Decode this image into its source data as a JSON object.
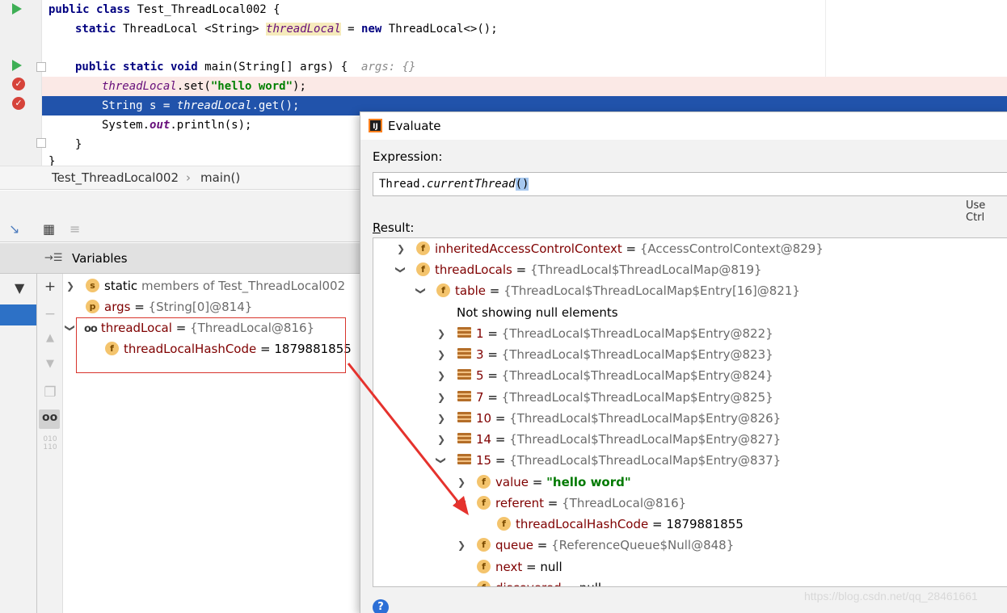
{
  "editor": {
    "class_decl": "public class Test_ThreadLocal002 {",
    "kw_public_class": "public class",
    "class_name": "Test_ThreadLocal002 {",
    "field_kw": "static",
    "field_type": "ThreadLocal <String>",
    "field_name": "threadLocal",
    "field_rest": "= new ThreadLocal<>();",
    "kw_new": "new",
    "field_ctor": "ThreadLocal<>();",
    "main_kw": "public static void",
    "main_sig": "main(String[] args) {",
    "main_hint": "args: {}",
    "line_set_var": "threadLocal",
    "line_set_call": ".set(",
    "line_set_str": "\"hello word\"",
    "line_set_end": ");",
    "line_get_pre": "String s = ",
    "line_get_var": "threadLocal",
    "line_get_end": ".get();",
    "line_print_pre": "System.",
    "line_print_out": "out",
    "line_print_end": ".println(s);",
    "close_brace": "}",
    "close_brace2": "}"
  },
  "breadcrumb": {
    "file": "Test_ThreadLocal002",
    "sep": "›",
    "method": "main()"
  },
  "variables": {
    "header": "Variables",
    "rows": [
      {
        "badge": "s",
        "name": "static",
        "rest": "members of Test_ThreadLocal002"
      },
      {
        "badge": "p",
        "name": "args",
        "eq": " = ",
        "value": "{String[0]@814}"
      },
      {
        "name": "threadLocal",
        "eq": " = ",
        "value": "{ThreadLocal@816}"
      },
      {
        "badge": "f",
        "name": "threadLocalHashCode",
        "eq": " = ",
        "value": "1879881855"
      }
    ]
  },
  "evaluate": {
    "title": "Evaluate",
    "expression_label": "Expression:",
    "expression_main": "Thread.",
    "expression_method": "currentThread",
    "expression_paren": "()",
    "use_ctrl": "Use Ctrl",
    "result_label_u": "R",
    "result_label_rest": "esult:",
    "tree": [
      {
        "name": "inheritedAccessControlContext",
        "eq": " = ",
        "value": "{AccessControlContext@829}"
      },
      {
        "name": "threadLocals",
        "eq": " = ",
        "value": "{ThreadLocal$ThreadLocalMap@819}"
      },
      {
        "name": "table",
        "eq": " = ",
        "value": "{ThreadLocal$ThreadLocalMap$Entry[16]@821}"
      },
      {
        "text": "Not showing null elements"
      },
      {
        "name": "1",
        "eq": " = ",
        "value": "{ThreadLocal$ThreadLocalMap$Entry@822}"
      },
      {
        "name": "3",
        "eq": " = ",
        "value": "{ThreadLocal$ThreadLocalMap$Entry@823}"
      },
      {
        "name": "5",
        "eq": " = ",
        "value": "{ThreadLocal$ThreadLocalMap$Entry@824}"
      },
      {
        "name": "7",
        "eq": " = ",
        "value": "{ThreadLocal$ThreadLocalMap$Entry@825}"
      },
      {
        "name": "10",
        "eq": " = ",
        "value": "{ThreadLocal$ThreadLocalMap$Entry@826}"
      },
      {
        "name": "14",
        "eq": " = ",
        "value": "{ThreadLocal$ThreadLocalMap$Entry@827}"
      },
      {
        "name": "15",
        "eq": " = ",
        "value": "{ThreadLocal$ThreadLocalMap$Entry@837}"
      },
      {
        "name": "value",
        "eq": " = ",
        "value": "\"hello word\""
      },
      {
        "name": "referent",
        "eq": " = ",
        "value": "{ThreadLocal@816}"
      },
      {
        "name": "threadLocalHashCode",
        "eq": " = ",
        "value": "1879881855"
      },
      {
        "name": "queue",
        "eq": " = ",
        "value": "{ReferenceQueue$Null@848}"
      },
      {
        "name": "next",
        "eq": " = ",
        "value": "null"
      },
      {
        "name": "discovered",
        "eq": " = ",
        "value": "null"
      }
    ]
  },
  "watermark": "https://blog.csdn.net/qq_28461661",
  "colors": {
    "keyword": "#000080",
    "field": "#660e7a",
    "string": "#008000",
    "selection": "#2153ab",
    "breakpoint_line": "#fbe9e6",
    "annotation_red": "#d8342c"
  }
}
